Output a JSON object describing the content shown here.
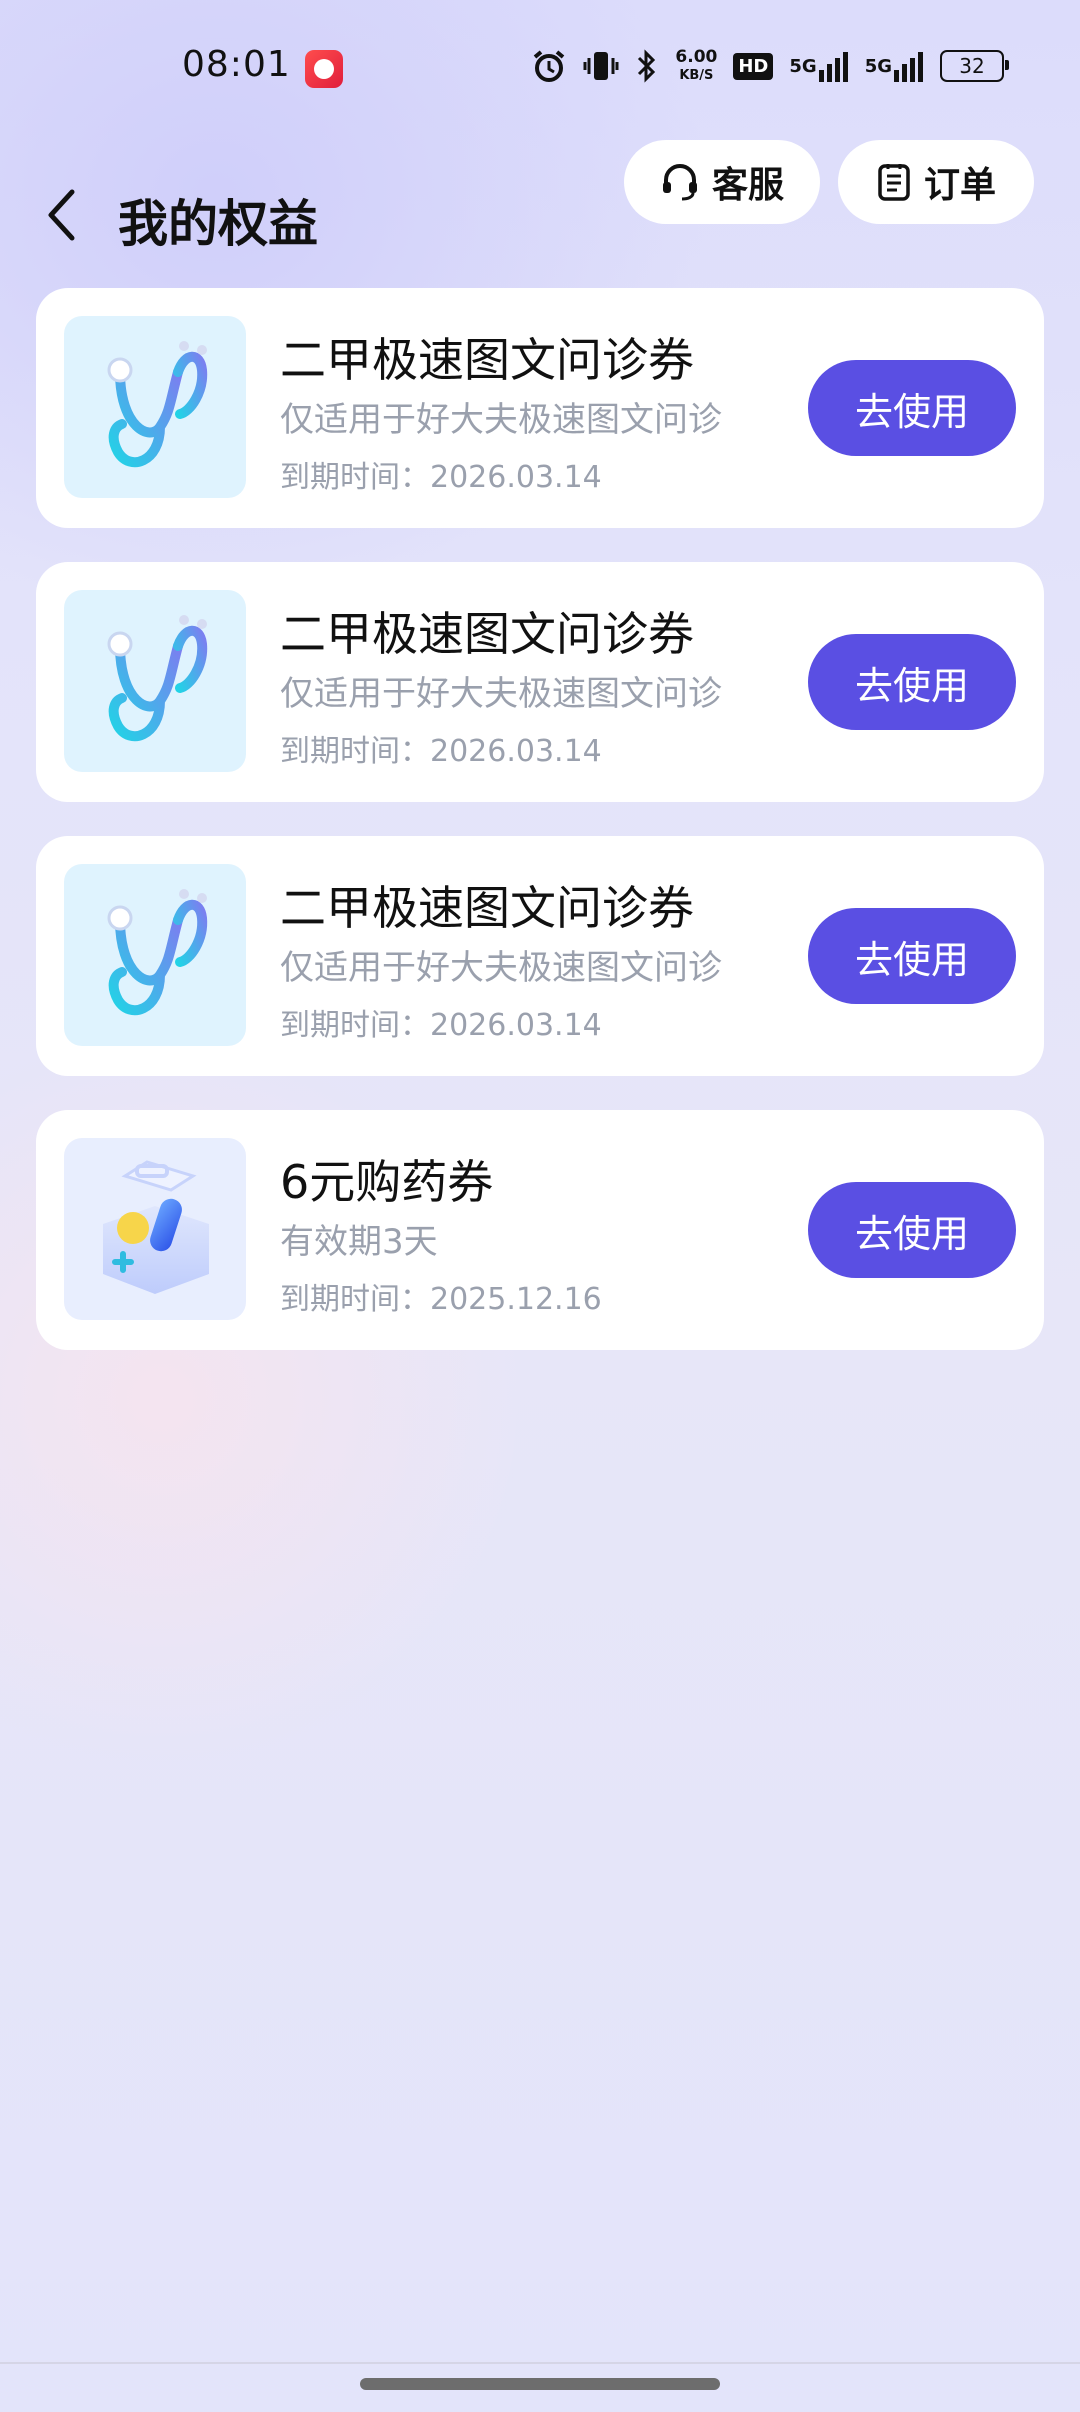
{
  "status_bar": {
    "time": "08:01",
    "net_speed_value": "6.00",
    "net_speed_unit": "KB/S",
    "hd_label": "HD",
    "signal1_label": "5G",
    "signal2_label": "5G",
    "battery": "32"
  },
  "header": {
    "title": "我的权益",
    "service_label": "客服",
    "orders_label": "订单"
  },
  "cards": [
    {
      "title": "二甲极速图文问诊券",
      "desc": "仅适用于好大夫极速图文问诊",
      "expiry": "到期时间：2026.03.14",
      "button": "去使用",
      "icon": "stethoscope-icon"
    },
    {
      "title": "二甲极速图文问诊券",
      "desc": "仅适用于好大夫极速图文问诊",
      "expiry": "到期时间：2026.03.14",
      "button": "去使用",
      "icon": "stethoscope-icon"
    },
    {
      "title": "二甲极速图文问诊券",
      "desc": "仅适用于好大夫极速图文问诊",
      "expiry": "到期时间：2026.03.14",
      "button": "去使用",
      "icon": "stethoscope-icon"
    },
    {
      "title": "6元购药券",
      "desc": "有效期3天",
      "expiry": "到期时间：2025.12.16",
      "button": "去使用",
      "icon": "medicine-box-icon"
    }
  ],
  "colors": {
    "accent": "#5a4fe3",
    "card_bg": "#ffffff",
    "muted_text": "#9aa0ad"
  }
}
